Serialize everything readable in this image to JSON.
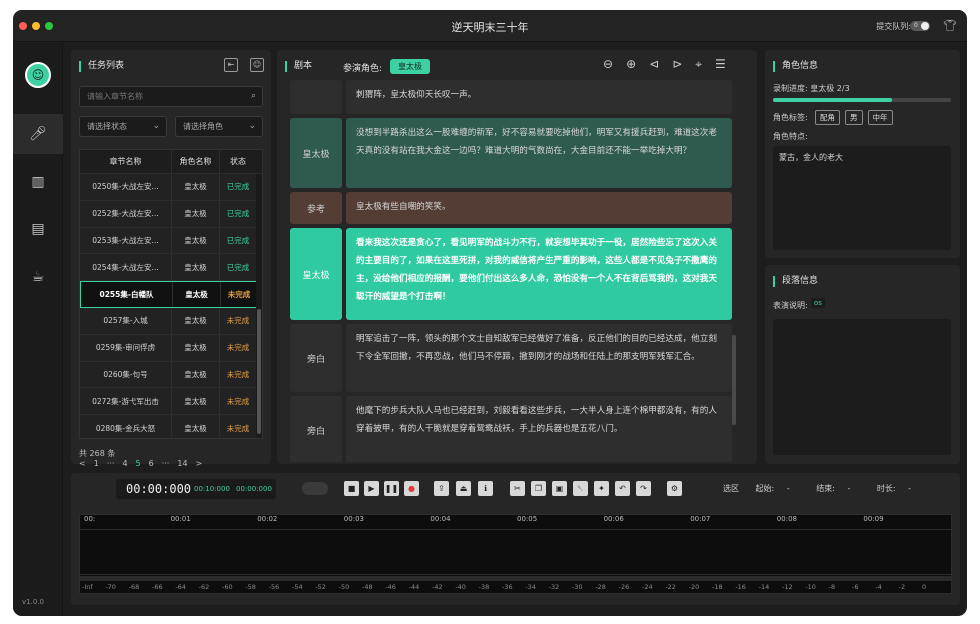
{
  "app": {
    "title": "逆天明末三十年",
    "queue_label": "提交队列:",
    "queue_count": "0",
    "version": "v1.0.0"
  },
  "colors": {
    "accent": "#3dd0a2",
    "accent_light": "#2fcaa0",
    "panel": "#262626",
    "ref": "#533d35"
  },
  "nav": {
    "items": [
      "mic-icon",
      "library-icon",
      "document-money-icon",
      "coffee-icon"
    ]
  },
  "task_list": {
    "title": "任务列表",
    "search_placeholder": "请输入章节名称",
    "status_select": "请选择状态",
    "role_select": "请选择角色",
    "columns": [
      "章节名称",
      "角色名称",
      "状态"
    ],
    "rows": [
      {
        "chapter": "0250集-大战左安...",
        "role": "皇太极",
        "status": "已完成",
        "done": true
      },
      {
        "chapter": "0252集-大战左安...",
        "role": "皇太极",
        "status": "已完成",
        "done": true
      },
      {
        "chapter": "0253集-大战左安...",
        "role": "皇太极",
        "status": "已完成",
        "done": true
      },
      {
        "chapter": "0254集-大战左安...",
        "role": "皇太极",
        "status": "已完成",
        "done": true
      },
      {
        "chapter": "0255集-白幡队",
        "role": "皇太极",
        "status": "未完成",
        "done": false,
        "selected": true
      },
      {
        "chapter": "0257集-入城",
        "role": "皇太极",
        "status": "未完成",
        "done": false
      },
      {
        "chapter": "0259集-审问俘虏",
        "role": "皇太极",
        "status": "未完成",
        "done": false
      },
      {
        "chapter": "0260集-句号",
        "role": "皇太极",
        "status": "未完成",
        "done": false
      },
      {
        "chapter": "0272集-游弋军出击",
        "role": "皇太极",
        "status": "未完成",
        "done": false
      },
      {
        "chapter": "0280集-金兵大怒",
        "role": "皇太极",
        "status": "未完成",
        "done": false
      }
    ],
    "total": "共 268 条",
    "pages": [
      "<",
      "1",
      "···",
      "4",
      "5",
      "6",
      "···",
      "14",
      ">"
    ]
  },
  "script": {
    "title": "剧本",
    "role_label": "参演角色:",
    "role_tag": "皇太极",
    "lines": [
      {
        "role": "",
        "text": "刺猬阵，皇太极仰天长叹一声。",
        "kind": "plain"
      },
      {
        "role": "皇太极",
        "text": "没想到半路杀出这么一股难缠的新军，好不容易就要吃掉他们，明军又有援兵赶到，难道这次老天真的没有站在我大金这一边吗？难道大明的气数尚在，大金目前还不能一举吃掉大明？",
        "kind": "done",
        "mark": "已"
      },
      {
        "role": "参考",
        "text": "皇太极有些自嘲的笑笑。",
        "kind": "ref"
      },
      {
        "role": "皇太极",
        "text": "看来我这次还是贪心了，看见明军的战斗力不行，就妄想毕其功于一役，居然险些忘了这次入关的主要目的了，如果在这里死拼，对我的威信将产生严重的影响，这些人都是不见兔子不撒鹰的主，没给他们相应的报酬，要他们付出这么多人命，恐怕没有一个人不在背后骂我的，这对我天聪汗的威望是个打击啊！",
        "kind": "active",
        "mark": "簡"
      },
      {
        "role": "旁白",
        "text": "明军追击了一阵，领头的那个文士自知敌军已经做好了准备，反正他们的目的已经达成，他立刻下令全军回撤，不再恋战，他们马不停蹄，撤到刚才的战场和任陆上的那支明军残军汇合。",
        "kind": "plain"
      },
      {
        "role": "旁白",
        "text": "他麾下的步兵大队人马也已经赶到，刘毅看看这些步兵，一大半人身上连个棉甲都没有，有的人穿着披甲，有的人干脆就是穿着鸳鸯战袄，手上的兵器也是五花八门。",
        "kind": "plain"
      }
    ]
  },
  "role_info": {
    "title": "角色信息",
    "progress_label": "录制进度:",
    "progress_value": "皇太极 2/3",
    "progress_fraction": 0.667,
    "tags_label": "角色标签:",
    "tags": [
      "配角",
      "男",
      "中年"
    ],
    "traits_label": "角色特点:",
    "traits": "蒙古，金人的老大"
  },
  "paragraph_info": {
    "title": "段落信息",
    "label": "表演说明:",
    "value": "os"
  },
  "timeline": {
    "time": "00:00:000",
    "time_a": "00:10:000",
    "time_b": "00:00:000",
    "select_label": "选区",
    "start_label": "起始:",
    "start_value": "-",
    "end_label": "结束:",
    "end_value": "-",
    "dur_label": "时长:",
    "dur_value": "-",
    "ticks": [
      "00:",
      "00:01",
      "00:02",
      "00:03",
      "00:04",
      "00:05",
      "00:06",
      "00:07",
      "00:08",
      "00:09"
    ],
    "db": [
      "-Inf",
      "-70",
      "-68",
      "-66",
      "-64",
      "-62",
      "-60",
      "-58",
      "-56",
      "-54",
      "-52",
      "-50",
      "-48",
      "-46",
      "-44",
      "-42",
      "-40",
      "-38",
      "-36",
      "-34",
      "-32",
      "-30",
      "-28",
      "-26",
      "-24",
      "-22",
      "-20",
      "-18",
      "-16",
      "-14",
      "-12",
      "-10",
      "-8",
      "-6",
      "-4",
      "-2",
      "0"
    ]
  }
}
